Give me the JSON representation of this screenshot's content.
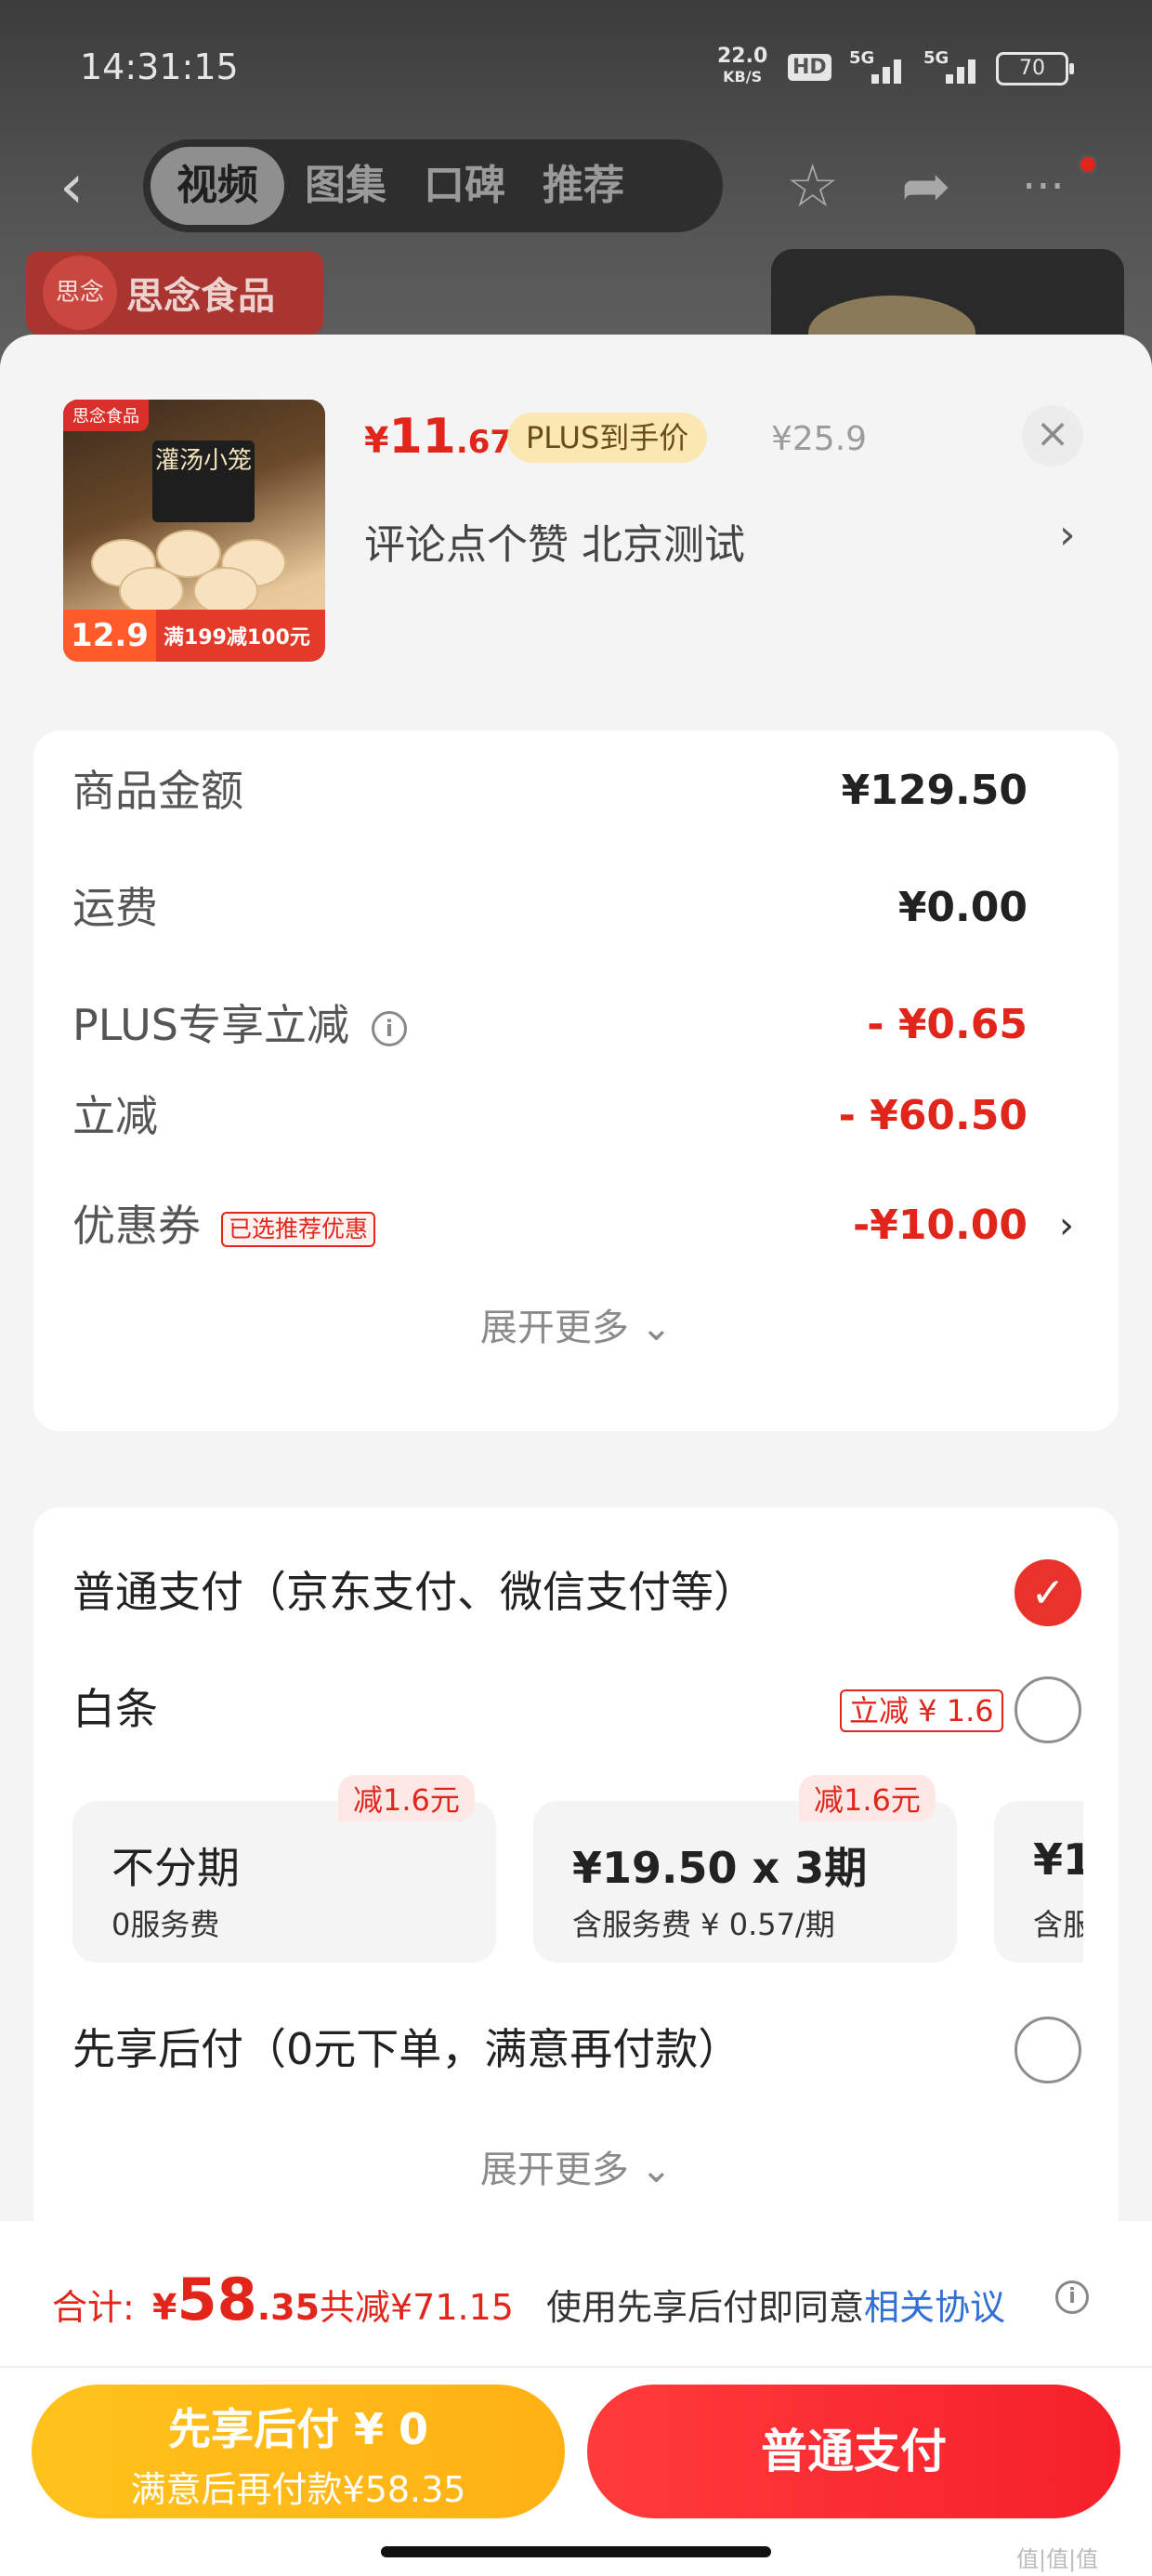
{
  "status": {
    "time": "14:31:15",
    "speed_value": "22.0",
    "speed_unit": "KB/S",
    "hd": "HD",
    "net1": "5G",
    "net2": "5G",
    "battery": "70"
  },
  "nav": {
    "back_icon": "chevron-left-icon",
    "tabs": [
      {
        "label": "视频",
        "active": true
      },
      {
        "label": "图集",
        "active": false
      },
      {
        "label": "口碑",
        "active": false
      },
      {
        "label": "推荐",
        "active": false
      }
    ],
    "icons": [
      "star-icon",
      "share-icon",
      "more-icon"
    ]
  },
  "background": {
    "brand_logo": "思念",
    "brand_name": "思念食品"
  },
  "product": {
    "image_brand_tag": "思念食品",
    "image_title": "灌汤小笼",
    "image_price": "12.9",
    "image_deal": "满199减100元",
    "price_yen": "¥",
    "price_int": "11",
    "price_dec": ".67",
    "plus_badge": "PLUS到手价",
    "original_price": "¥25.9",
    "spec": "评论点个赞  北京测试",
    "close_icon": "close-icon"
  },
  "summary": {
    "rows": [
      {
        "label": "商品金额",
        "value": "¥129.50"
      },
      {
        "label": "运费",
        "value": "¥0.00"
      },
      {
        "label": "PLUS专享立减",
        "value": "- ¥0.65"
      },
      {
        "label": "立减",
        "value": "- ¥60.50"
      },
      {
        "label": "优惠券",
        "value": "-¥10.00",
        "tag": "已选推荐优惠"
      }
    ],
    "expand": "展开更多 ⌄"
  },
  "payment": {
    "normal_label": "普通支付（京东支付、微信支付等）",
    "baitiao_label": "白条",
    "baitiao_tag": "立减 ¥ 1.6",
    "plans": [
      {
        "title": "不分期",
        "sub": "0服务费",
        "badge": "减1.6元"
      },
      {
        "title": "¥19.50 x 3期",
        "sub": "含服务费 ¥ 0.57/期",
        "badge": "减1.6元"
      },
      {
        "title": "¥1",
        "sub": "含服"
      }
    ],
    "later_label": "先享后付（0元下单，满意再付款）",
    "expand": "展开更多 ⌄"
  },
  "footer": {
    "total_label": "合计:",
    "total_yen": "¥",
    "total_int": "58",
    "total_dec": ".35",
    "total_save": "共减¥71.15",
    "agree_text": "使用先享后付即同意",
    "agree_link": "相关协议",
    "btn_later_l1": "先享后付 ¥ 0",
    "btn_later_l2": "满意后再付款¥58.35",
    "btn_normal": "普通支付",
    "watermark": "值|值|值"
  },
  "colors": {
    "accent_red": "#e1251b",
    "plus_gold": "#fbe7b2",
    "later_yellow": "#ffc21c",
    "link_blue": "#2f6fd6"
  }
}
